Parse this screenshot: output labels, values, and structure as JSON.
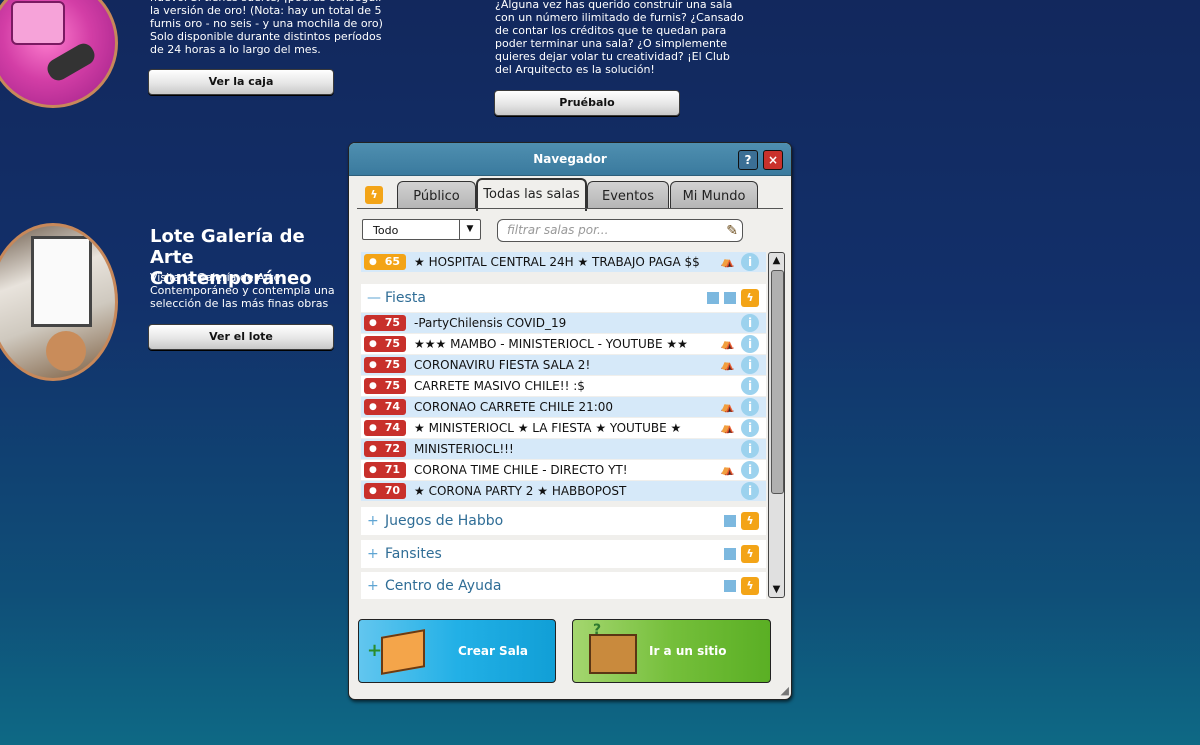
{
  "promo1": {
    "text": "nuevo. Si tienes suerte, ¡podrás conseguir la versión de oro! (Nota: hay un total de 5 furnis oro - no seis - y una mochila de oro) Solo disponible durante distintos períodos de 24 horas a lo largo del mes.",
    "button": "Ver la caja"
  },
  "promo2": {
    "text": "¿Alguna vez has querido construir una sala con un número ilimitado de furnis? ¿Cansado de contar los créditos que te quedan para poder terminar una sala? ¿O simplemente quieres dejar volar tu creatividad? ¡El Club del Arquitecto es la solución!",
    "button": "Pruébalo"
  },
  "promo3": {
    "title": "Lote Galería de Arte Contemporáneo",
    "text": "Visita la Galería de Arte Contemporáneo y contempla una selección de las más finas obras experimentales y actuales.",
    "button": "Ver el lote"
  },
  "navigator": {
    "title": "Navegador",
    "help": "?",
    "close": "×",
    "tabs": [
      "Público",
      "Todas las salas",
      "Eventos",
      "Mi Mundo"
    ],
    "active_tab": "Todas las salas",
    "select_value": "Todo",
    "filter_placeholder": "filtrar salas por...",
    "top_room": {
      "users": "65",
      "name": "★ HOSPITAL CENTRAL 24H ★ TRABAJO PAGA $$",
      "group": true
    },
    "category_open": "Fiesta",
    "rooms": [
      {
        "users": "75",
        "name": "-PartyChilensis COVID_19",
        "group": false
      },
      {
        "users": "75",
        "name": "★★★ MAMBO -  MINISTERIOCL  - YOUTUBE ★★",
        "group": true
      },
      {
        "users": "75",
        "name": "CORONAVIRU FIESTA SALA 2!",
        "group": true
      },
      {
        "users": "75",
        "name": "CARRETE MASIVO CHILE!! :$",
        "group": false
      },
      {
        "users": "74",
        "name": "CORONAO CARRETE CHILE 21:00",
        "group": true
      },
      {
        "users": "74",
        "name": "★ MINISTERIOCL ★ LA FIESTA ★ YOUTUBE ★",
        "group": true
      },
      {
        "users": "72",
        "name": "MINISTERIOCL!!!",
        "group": false
      },
      {
        "users": "71",
        "name": "CORONA TIME CHILE - DIRECTO YT!",
        "group": true
      },
      {
        "users": "70",
        "name": "★ CORONA PARTY 2 ★ HABBOPOST",
        "group": false
      }
    ],
    "categories_closed": [
      "Juegos de Habbo",
      "Fansites",
      "Centro de Ayuda"
    ],
    "create_room": "Crear Sala",
    "go_new": "Ir a un sitio nuevo"
  },
  "colors": {
    "user_red": "#c8302b",
    "user_orange": "#f3a417",
    "info": "#9cd2ee"
  }
}
